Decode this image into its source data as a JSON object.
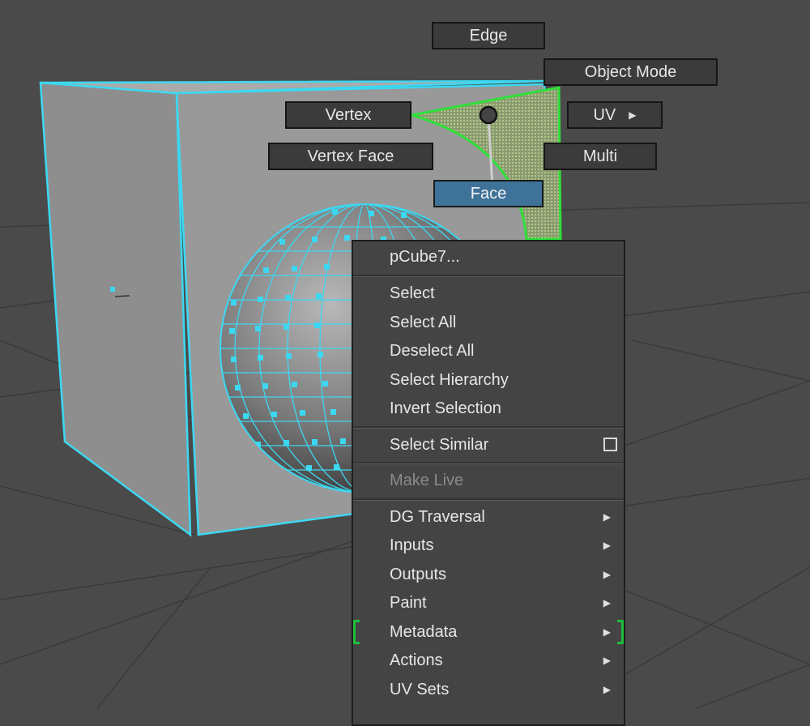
{
  "marking_menu": {
    "edge": "Edge",
    "object_mode": "Object Mode",
    "vertex": "Vertex",
    "uv": "UV",
    "vertex_face": "Vertex Face",
    "multi": "Multi",
    "face": "Face",
    "active_item": "Face"
  },
  "context_menu": {
    "title": "pCube7...",
    "select": "Select",
    "select_all": "Select All",
    "deselect_all": "Deselect All",
    "select_hierarchy": "Select Hierarchy",
    "invert_selection": "Invert Selection",
    "select_similar": "Select Similar",
    "make_live": "Make Live",
    "dg_traversal": "DG Traversal",
    "inputs": "Inputs",
    "outputs": "Outputs",
    "paint": "Paint",
    "metadata": "Metadata",
    "actions": "Actions",
    "uv_sets": "UV Sets"
  },
  "colors": {
    "background": "#4a4a4a",
    "wireframe": "#3cd8f2",
    "selection_green": "#2fe03a",
    "active_button": "#3f7299"
  }
}
